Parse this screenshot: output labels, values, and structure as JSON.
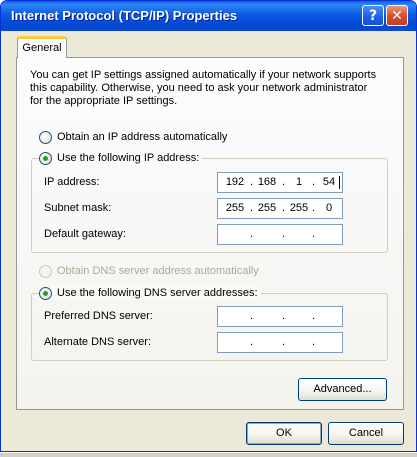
{
  "window": {
    "title": "Internet Protocol (TCP/IP) Properties"
  },
  "titlebar": {
    "help_glyph": "?",
    "close_glyph": "✕"
  },
  "tabs": [
    {
      "label": "General"
    }
  ],
  "intro_text": "You can get IP settings assigned automatically if your network supports this capability. Otherwise, you need to ask your network administrator for the appropriate IP settings.",
  "ip": {
    "auto_label": "Obtain an IP address automatically",
    "manual_label": "Use the following IP address:",
    "selected": "manual",
    "fields": [
      {
        "label": "IP address:",
        "octets": [
          "192",
          "168",
          "1",
          "54"
        ]
      },
      {
        "label": "Subnet mask:",
        "octets": [
          "255",
          "255",
          "255",
          "0"
        ]
      },
      {
        "label": "Default gateway:",
        "octets": [
          "",
          "",
          "",
          ""
        ]
      }
    ]
  },
  "dns": {
    "auto_label": "Obtain DNS server address automatically",
    "manual_label": "Use the following DNS server addresses:",
    "selected": "manual",
    "fields": [
      {
        "label": "Preferred DNS server:",
        "octets": [
          "",
          "",
          "",
          ""
        ]
      },
      {
        "label": "Alternate DNS server:",
        "octets": [
          "",
          "",
          "",
          ""
        ]
      }
    ]
  },
  "buttons": {
    "advanced": "Advanced...",
    "ok": "OK",
    "cancel": "Cancel"
  },
  "colors": {
    "title_bar": "#0A5FE5",
    "dialog_bg": "#ECE9D8",
    "radio_dot": "#21A121",
    "close_button": "#D5532F"
  }
}
